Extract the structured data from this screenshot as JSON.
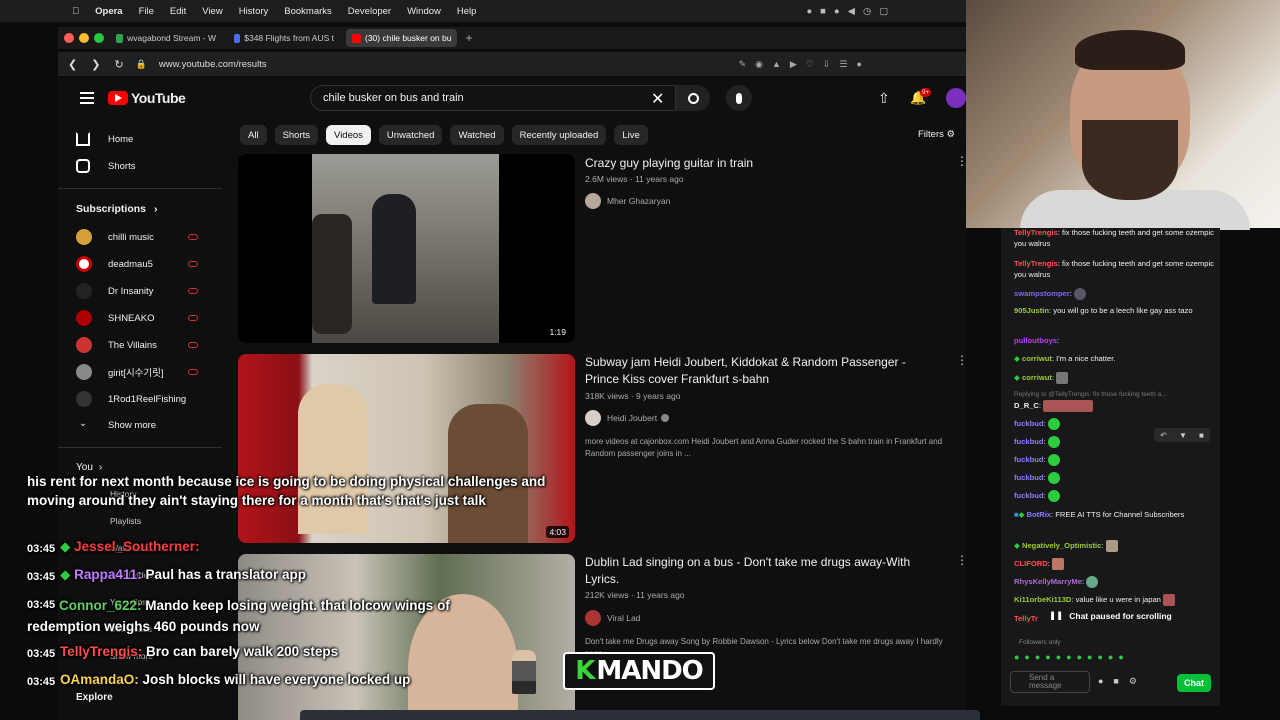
{
  "menubar": {
    "app": "Opera",
    "items": [
      "File",
      "Edit",
      "View",
      "History",
      "Bookmarks",
      "Developer",
      "Window",
      "Help"
    ]
  },
  "browser": {
    "tabs": [
      {
        "label": "wvagabond Stream - W",
        "color": "#2ea44f"
      },
      {
        "label": "$348 Flights from AUS t",
        "color": "#4a6cf7"
      },
      {
        "label": "(30) chile busker on bu",
        "color": "#ff0000"
      }
    ],
    "url": "www.youtube.com/results"
  },
  "youtube": {
    "logo": "YouTube",
    "search_query": "chile busker on bus and train",
    "notifications": "9+",
    "filters": [
      "All",
      "Shorts",
      "Videos",
      "Unwatched",
      "Watched",
      "Recently uploaded",
      "Live"
    ],
    "filters_label": "Filters",
    "sidebar": {
      "home": "Home",
      "shorts": "Shorts",
      "subscriptions_title": "Subscriptions",
      "subscriptions": [
        "chilli music",
        "deadmau5",
        "Dr Insanity",
        "SHNEAKO",
        "The Villains",
        "girit[시수기릿]",
        "1Rod1ReelFishing"
      ],
      "show_more": "Show more",
      "you": "You",
      "you_items": [
        "History",
        "Playlists",
        "Watch later",
        "Liked videos",
        "Your clips",
        "Downloads"
      ],
      "show_more2": "Show more",
      "explore": "Explore"
    },
    "results": [
      {
        "title": "Crazy guy playing guitar in train",
        "meta": "2.6M views · 11 years ago",
        "channel": "Mher Ghazaryan",
        "duration": "1:19",
        "desc": ""
      },
      {
        "title": "Subway jam Heidi Joubert, Kiddokat & Random Passenger - Prince Kiss cover Frankfurt s-bahn",
        "meta": "318K views · 9 years ago",
        "channel": "Heidi Joubert",
        "duration": "4:03",
        "desc": "more videos at cajonbox.com Heidi Joubert and Anna Guder rocked the S bahn train in Frankfurt and Random passenger joins in ..."
      },
      {
        "title": "Dublin Lad singing on a bus - Don't take me drugs away-With Lyrics.",
        "meta": "212K views · 11 years ago",
        "channel": "Viral Lad",
        "duration": "",
        "desc": "Don't take me Drugs away Song by Robbie Dawson - Lyrics below Don't take me drugs away I hardly seen"
      }
    ]
  },
  "chat": {
    "messages": [
      {
        "user": "TellyTrengis",
        "color": "#ff4f4f",
        "text": ": fix those fucking teeth and get some ozempic you walrus"
      },
      {
        "user": "TellyTrengis",
        "color": "#ff4f4f",
        "text": ": fix those fucking teeth and get some ozempic you walrus"
      },
      {
        "user": "swampstomper",
        "color": "#7b68ee",
        "text": ":"
      },
      {
        "user": "905Justin",
        "color": "#9acd32",
        "text": ": you will go to be a leech like gay ass tazo"
      },
      {
        "user": "pulloutboys",
        "color": "#b83dff",
        "text": ":"
      },
      {
        "user": "corriwut",
        "color": "#9acd32",
        "text": ": I'm a nice chatter."
      },
      {
        "user": "corriwut",
        "color": "#9acd32",
        "text": ":"
      },
      {
        "user": "Replying to @TellyTrengis: fix those fucking teeth a...",
        "color": "#888888",
        "text": ""
      },
      {
        "user": "D_R_C",
        "color": "#e6e6e6",
        "text": ":"
      },
      {
        "user": "fuckbud",
        "color": "#8a7dff",
        "text": ":"
      },
      {
        "user": "fuckbud",
        "color": "#8a7dff",
        "text": ":"
      },
      {
        "user": "fuckbud",
        "color": "#8a7dff",
        "text": ":"
      },
      {
        "user": "fuckbud",
        "color": "#8a7dff",
        "text": ":"
      },
      {
        "user": "fuckbud",
        "color": "#8a7dff",
        "text": ":"
      },
      {
        "user": "BotRix",
        "color": "#8a7dff",
        "text": ": FREE AI TTS for Channel Subscribers"
      },
      {
        "user": "Negatively_Optimistic",
        "color": "#9acd32",
        "text": ":"
      },
      {
        "user": "CLIFORD",
        "color": "#ff4f4f",
        "text": ":"
      },
      {
        "user": "RhysKellyMarryMe",
        "color": "#b06bd6",
        "text": ":"
      },
      {
        "user": "Ki11orbeKi113D",
        "color": "#9acd32",
        "text": ": value like u were in japan"
      },
      {
        "user": "TellyTr",
        "color": "#ff4f4f",
        "text": ""
      }
    ],
    "paused": "Chat paused for scrolling",
    "followers_only": "Followers only",
    "input_placeholder": "Send a message",
    "chat_button": "Chat"
  },
  "overlay": {
    "caption": "his rent for next month because ice is going to be doing physical challenges and moving around they ain't staying there for a month that's that's just talk",
    "chat": [
      {
        "time": "03:45",
        "user": "Jessel_Southerner:",
        "text": "",
        "color": "#ff3b3b"
      },
      {
        "time": "03:45",
        "user": "Rappa411:",
        "text": "Paul has a translator app",
        "color": "#c27cff"
      },
      {
        "time": "03:45",
        "user": "Connor_622:",
        "text": "Mando keep losing weight. that lolcow wings of redemption weighs 460 pounds now",
        "color": "#5dd35d"
      },
      {
        "time": "03:45",
        "user": "TellyTrengis:",
        "text": "Bro can barely walk 200 steps",
        "color": "#ff4f4f"
      },
      {
        "time": "03:45",
        "user": "OAmandaO:",
        "text": "Josh blocks will have everyone locked up",
        "color": "#ffd34f"
      }
    ],
    "badge": "MANDO"
  }
}
